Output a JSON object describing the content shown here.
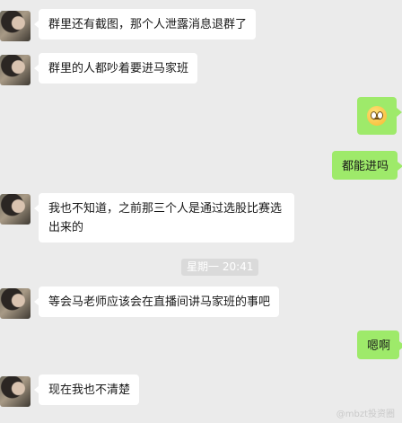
{
  "chat": {
    "messages": [
      {
        "side": "left",
        "text": "群里还有截图，那个人泄露消息退群了"
      },
      {
        "side": "left",
        "text": "群里的人都吵着要进马家班"
      },
      {
        "side": "right",
        "emoji": "shocked-face-emoji"
      },
      {
        "side": "right",
        "text": "都能进吗"
      },
      {
        "side": "left",
        "text": "我也不知道，之前那三个人是通过选股比赛选出来的"
      },
      {
        "side": "left",
        "text": "等会马老师应该会在直播间讲马家班的事吧"
      },
      {
        "side": "right",
        "text": "嗯啊"
      },
      {
        "side": "left",
        "text": "现在我也不清楚"
      }
    ],
    "timestamp": "星期一 20:41",
    "watermark": "@mbzt投资圈"
  },
  "colors": {
    "background": "#ebebeb",
    "incoming_bubble": "#ffffff",
    "outgoing_bubble": "#9eea6a",
    "timestamp_bg": "#dadada"
  }
}
